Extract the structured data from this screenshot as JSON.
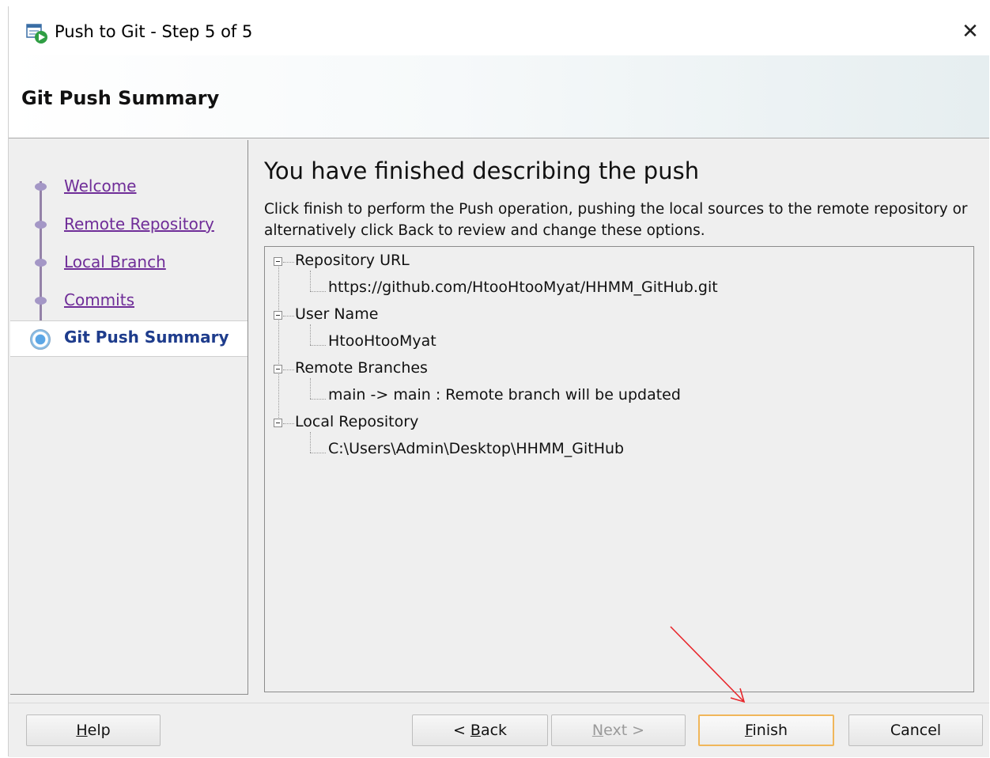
{
  "window": {
    "title": "Push to Git - Step 5 of 5",
    "close_glyph": "✕"
  },
  "header": {
    "title": "Git Push Summary"
  },
  "steps": [
    {
      "label": "Welcome",
      "state": "visited"
    },
    {
      "label": "Remote Repository",
      "state": "visited"
    },
    {
      "label": "Local Branch",
      "state": "visited"
    },
    {
      "label": "Commits",
      "state": "visited"
    },
    {
      "label": "Git Push Summary",
      "state": "current"
    }
  ],
  "main": {
    "heading": "You have finished describing the push",
    "description": "Click finish to perform the Push operation, pushing the local sources to the remote repository or alternatively click Back to review and change these options.",
    "tree": [
      {
        "label": "Repository URL",
        "child": "https://github.com/HtooHtooMyat/HHMM_GitHub.git"
      },
      {
        "label": "User Name",
        "child": "HtooHtooMyat"
      },
      {
        "label": "Remote Branches",
        "child": "main -> main : Remote branch will be updated"
      },
      {
        "label": "Local Repository",
        "child": "C:\\Users\\Admin\\Desktop\\HHMM_GitHub"
      }
    ]
  },
  "buttons": {
    "help": {
      "mnemonic": "H",
      "rest": "elp"
    },
    "back": {
      "prefix": "< ",
      "mnemonic": "B",
      "rest": "ack"
    },
    "next": {
      "mnemonic": "N",
      "rest": "ext >"
    },
    "finish": {
      "mnemonic": "F",
      "rest": "inish"
    },
    "cancel": {
      "label": "Cancel"
    }
  },
  "colors": {
    "visited_link": "#6f2d98",
    "current_step": "#1e3c8c",
    "default_button_border": "#f0b65a",
    "annotation_arrow": "#e8262b"
  }
}
